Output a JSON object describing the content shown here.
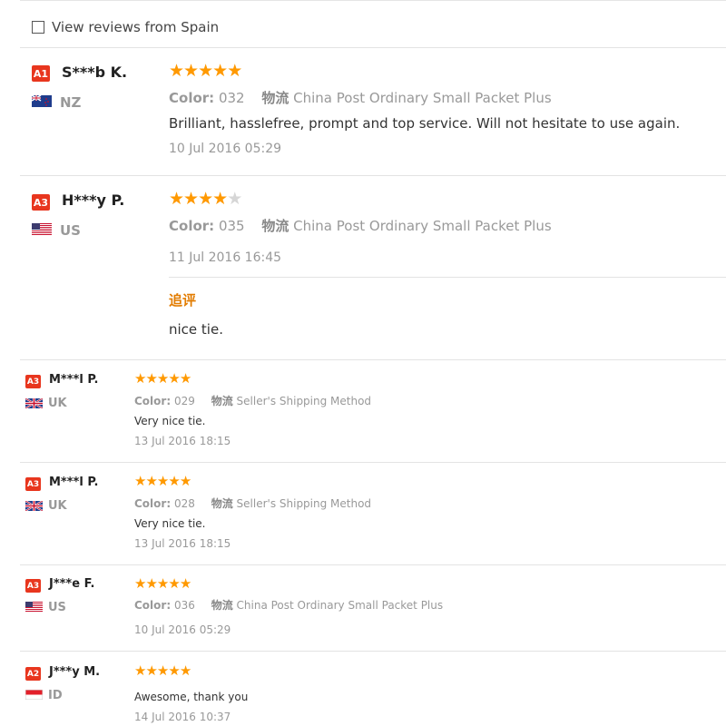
{
  "filter": {
    "label": "View reviews from Spain",
    "checked": false
  },
  "labels": {
    "color": "Color:",
    "shipping": "物流",
    "followup": "追评"
  },
  "colors": {
    "star": "#ff9900",
    "badge": "#e8361e",
    "followup": "#e27c00"
  },
  "reviews": [
    {
      "badge": "A1",
      "name": "S***b K.",
      "country": "NZ",
      "flag_icon": "new-zealand-flag-icon",
      "rating": 5,
      "color_code": "032",
      "shipping": "China Post Ordinary Small Packet Plus",
      "text": "Brilliant, hasslefree, prompt and top service. Will not hesitate to use again.",
      "date": "10 Jul 2016 05:29"
    },
    {
      "badge": "A3",
      "name": "H***y P.",
      "country": "US",
      "flag_icon": "us-flag-icon",
      "rating": 4,
      "color_code": "035",
      "shipping": "China Post Ordinary Small Packet Plus",
      "text": "",
      "date": "11 Jul 2016 16:45",
      "followup_text": "nice tie."
    },
    {
      "badge": "A3",
      "name": "M***l P.",
      "country": "UK",
      "flag_icon": "uk-flag-icon",
      "rating": 5,
      "color_code": "029",
      "shipping": "Seller's Shipping Method",
      "text": "Very nice tie.",
      "date": "13 Jul 2016 18:15"
    },
    {
      "badge": "A3",
      "name": "M***l P.",
      "country": "UK",
      "flag_icon": "uk-flag-icon",
      "rating": 5,
      "color_code": "028",
      "shipping": "Seller's Shipping Method",
      "text": "Very nice tie.",
      "date": "13 Jul 2016 18:15"
    },
    {
      "badge": "A3",
      "name": "J***e F.",
      "country": "US",
      "flag_icon": "us-flag-icon",
      "rating": 5,
      "color_code": "036",
      "shipping": "China Post Ordinary Small Packet Plus",
      "text": "",
      "date": "10 Jul 2016 05:29"
    },
    {
      "badge": "A2",
      "name": "J***y M.",
      "country": "ID",
      "flag_icon": "indonesia-flag-icon",
      "rating": 5,
      "color_code": "",
      "shipping": "",
      "text": "Awesome, thank you",
      "date": "14 Jul 2016 10:37"
    }
  ]
}
